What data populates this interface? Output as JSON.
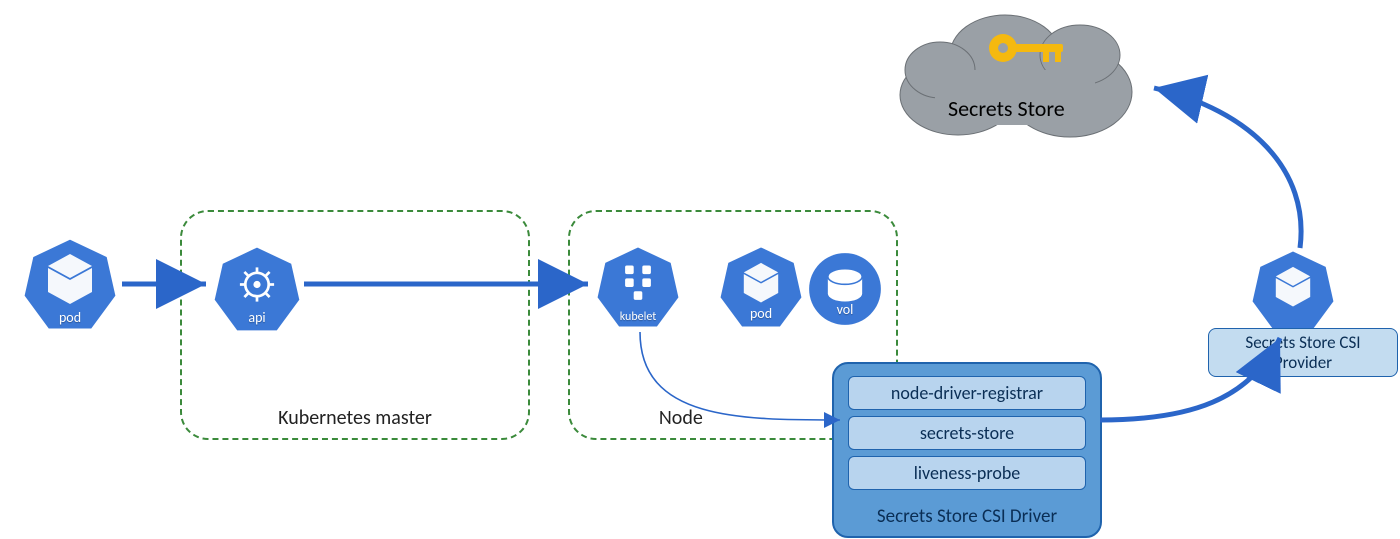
{
  "pod": {
    "label": "pod"
  },
  "master": {
    "group_label": "Kubernetes master",
    "api_label": "api"
  },
  "node": {
    "group_label": "Node",
    "kubelet_label": "kubelet",
    "pod_label": "pod",
    "vol_label": "vol"
  },
  "driver": {
    "items": {
      "registrar": "node-driver-registrar",
      "secrets_store": "secrets-store",
      "liveness": "liveness-probe"
    },
    "title": "Secrets Store CSI Driver"
  },
  "provider": {
    "label": "Secrets Store CSI\nProvider"
  },
  "cloud": {
    "label": "Secrets Store"
  }
}
